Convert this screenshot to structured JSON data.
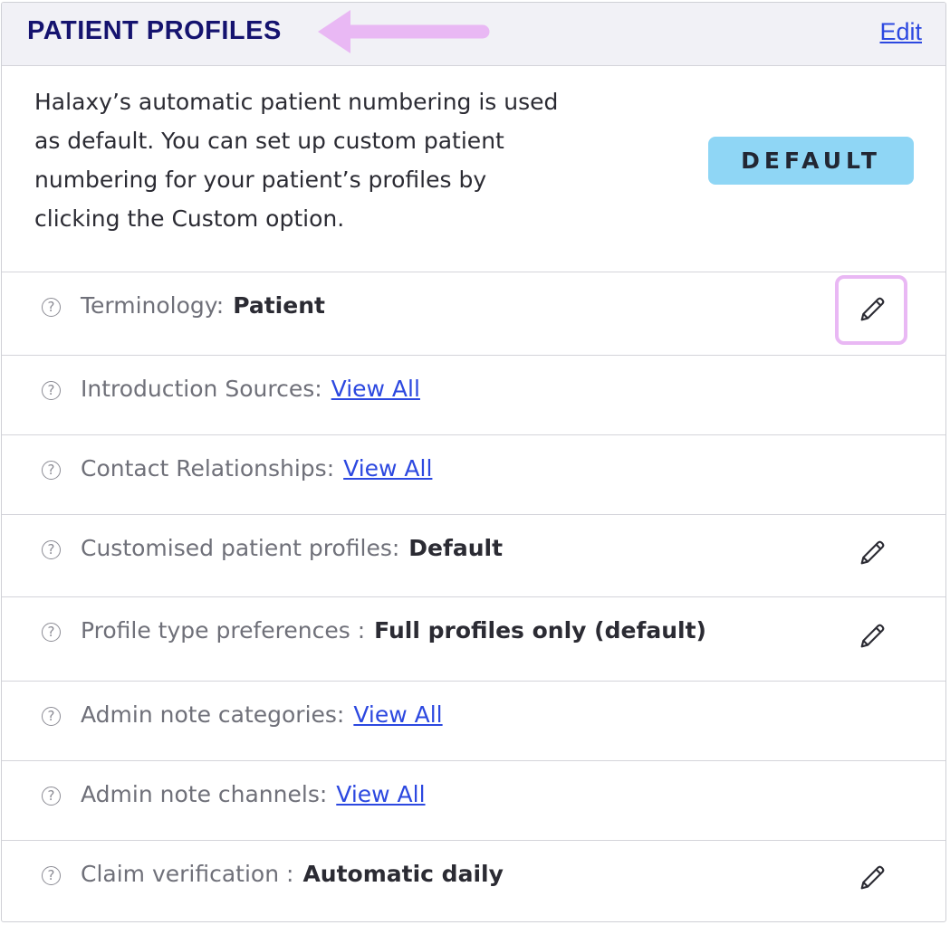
{
  "header": {
    "title": "PATIENT PROFILES",
    "edit_label": "Edit"
  },
  "intro": {
    "lines": [
      "Halaxy’s automatic patient numbering is used",
      "as default. You can set up custom patient",
      "numbering for your patient’s profiles by",
      "clicking the Custom option."
    ],
    "badge": "DEFAULT"
  },
  "rows": [
    {
      "label": "Terminology:",
      "value": "Patient"
    },
    {
      "label": "Introduction Sources:",
      "link": "View All"
    },
    {
      "label": "Contact Relationships:",
      "link": "View All"
    },
    {
      "label": "Customised patient profiles:",
      "value": "Default"
    },
    {
      "label": "Profile type preferences :",
      "value": "Full profiles only (default)"
    },
    {
      "label": "Admin note categories:",
      "link": "View All"
    },
    {
      "label": "Admin note channels:",
      "link": "View All"
    },
    {
      "label": "Claim verification :",
      "value": "Automatic daily"
    }
  ],
  "colors": {
    "title": "#15136f",
    "link": "#2c48e0",
    "badge_bg": "#8fd6f5",
    "annotation": "#e9b8f4"
  },
  "icons": {
    "help": "question-circle-icon",
    "edit": "pencil-icon",
    "annotation_arrow": "left-arrow-icon"
  }
}
